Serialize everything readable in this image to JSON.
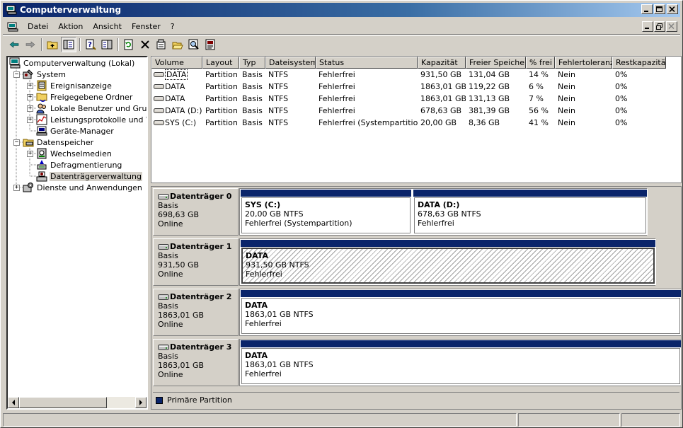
{
  "window": {
    "title": "Computerverwaltung"
  },
  "menu": [
    "Datei",
    "Aktion",
    "Ansicht",
    "Fenster",
    "?"
  ],
  "toolbar": [
    "back-icon",
    "forward-icon",
    "up-folder-icon",
    "show-tree-icon",
    "help-icon",
    "view-icon",
    "refresh-icon",
    "delete-icon",
    "properties-icon",
    "open-icon",
    "search-icon",
    "export-icon"
  ],
  "tree": {
    "root": "Computerverwaltung (Lokal)",
    "system": "System",
    "system_children": [
      "Ereignisanzeige",
      "Freigegebene Ordner",
      "Lokale Benutzer und Gruppe",
      "Leistungsprotokolle und War",
      "Geräte-Manager"
    ],
    "storage": "Datenspeicher",
    "storage_children": [
      "Wechselmedien",
      "Defragmentierung",
      "Datenträgerverwaltung"
    ],
    "services": "Dienste und Anwendungen"
  },
  "list": {
    "columns": [
      "Volume",
      "Layout",
      "Typ",
      "Dateisystem",
      "Status",
      "Kapazität",
      "Freier Speicher",
      "% frei",
      "Fehlertoleranz",
      "Restkapazität"
    ],
    "rows": [
      [
        "DATA",
        "Partition",
        "Basis",
        "NTFS",
        "Fehlerfrei",
        "931,50 GB",
        "131,04 GB",
        "14 %",
        "Nein",
        "0%"
      ],
      [
        "DATA",
        "Partition",
        "Basis",
        "NTFS",
        "Fehlerfrei",
        "1863,01 GB",
        "119,22 GB",
        "6 %",
        "Nein",
        "0%"
      ],
      [
        "DATA",
        "Partition",
        "Basis",
        "NTFS",
        "Fehlerfrei",
        "1863,01 GB",
        "131,13 GB",
        "7 %",
        "Nein",
        "0%"
      ],
      [
        "DATA (D:)",
        "Partition",
        "Basis",
        "NTFS",
        "Fehlerfrei",
        "678,63 GB",
        "381,39 GB",
        "56 %",
        "Nein",
        "0%"
      ],
      [
        "SYS (C:)",
        "Partition",
        "Basis",
        "NTFS",
        "Fehlerfrei (Systempartition)",
        "20,00 GB",
        "8,36 GB",
        "41 %",
        "Nein",
        "0%"
      ]
    ]
  },
  "disks": [
    {
      "name": "Datenträger 0",
      "type": "Basis",
      "size": "698,63 GB",
      "state": "Online",
      "partitions": [
        {
          "label": "SYS  (C:)",
          "info": "20,00 GB NTFS",
          "status": "Fehlerfrei (Systempartition)"
        },
        {
          "label": "DATA  (D:)",
          "info": "678,63 GB NTFS",
          "status": "Fehlerfrei"
        }
      ]
    },
    {
      "name": "Datenträger 1",
      "type": "Basis",
      "size": "931,50 GB",
      "state": "Online",
      "partitions": [
        {
          "label": "DATA",
          "info": "931,50 GB NTFS",
          "status": "Fehlerfrei"
        }
      ]
    },
    {
      "name": "Datenträger 2",
      "type": "Basis",
      "size": "1863,01 GB",
      "state": "Online",
      "partitions": [
        {
          "label": "DATA",
          "info": "1863,01 GB NTFS",
          "status": "Fehlerfrei"
        }
      ]
    },
    {
      "name": "Datenträger 3",
      "type": "Basis",
      "size": "1863,01 GB",
      "state": "Online",
      "partitions": [
        {
          "label": "DATA",
          "info": "1863,01 GB NTFS",
          "status": "Fehlerfrei"
        }
      ]
    }
  ],
  "legend": {
    "label": "Primäre Partition",
    "color": "#0a246a"
  }
}
